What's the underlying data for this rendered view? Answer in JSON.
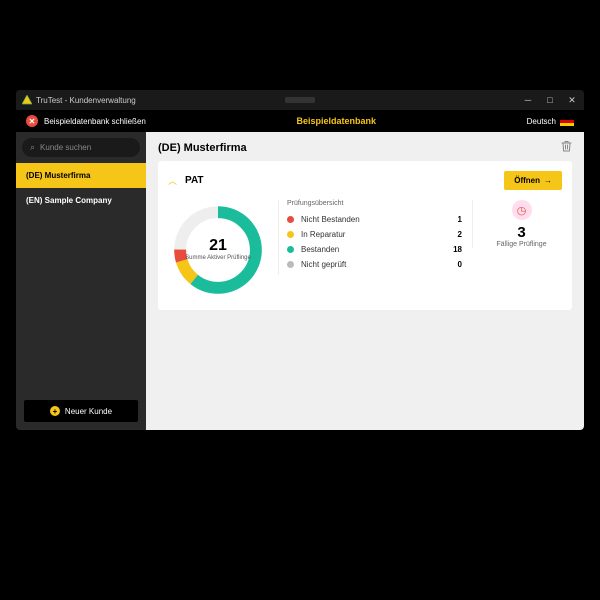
{
  "window": {
    "title": "TruTest - Kundenverwaltung"
  },
  "topbar": {
    "close_label": "Beispieldatenbank schließen",
    "db_title": "Beispieldatenbank",
    "language": "Deutsch"
  },
  "sidebar": {
    "search_placeholder": "Kunde suchen",
    "customers": [
      {
        "label": "(DE) Musterfirma",
        "active": true
      },
      {
        "label": "(EN) Sample Company",
        "active": false
      }
    ],
    "new_customer": "Neuer Kunde"
  },
  "main": {
    "title": "(DE) Musterfirma",
    "card": {
      "title": "PAT",
      "open": "Öffnen",
      "donut": {
        "total": "21",
        "label": "Summe Aktiver Prüflinge"
      },
      "stats_title": "Prüfungsübersicht",
      "stats": [
        {
          "label": "Nicht Bestanden",
          "value": "1",
          "color": "#e74c3c"
        },
        {
          "label": "In Reparatur",
          "value": "2",
          "color": "#f5c518"
        },
        {
          "label": "Bestanden",
          "value": "18",
          "color": "#1abc9c"
        },
        {
          "label": "Nicht geprüft",
          "value": "0",
          "color": "#bbb"
        }
      ],
      "due": {
        "value": "3",
        "label": "Fällige Prüflinge"
      }
    }
  },
  "chart_data": {
    "type": "pie",
    "title": "Summe Aktiver Prüflinge",
    "categories": [
      "Nicht Bestanden",
      "In Reparatur",
      "Bestanden",
      "Nicht geprüft"
    ],
    "values": [
      1,
      2,
      18,
      0
    ],
    "colors": [
      "#e74c3c",
      "#f5c518",
      "#1abc9c",
      "#bbb"
    ],
    "total": 21
  }
}
